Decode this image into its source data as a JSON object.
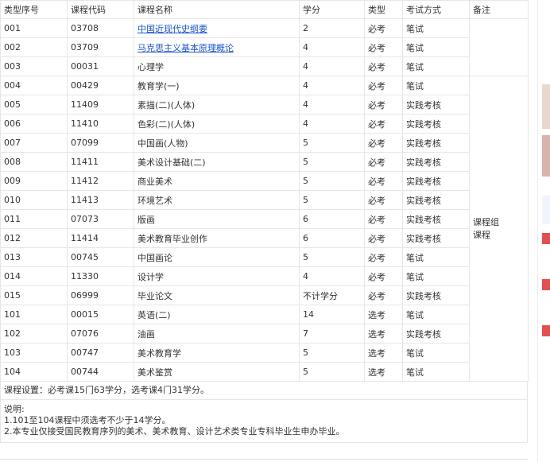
{
  "table": {
    "headers": [
      "类型序号",
      "课程代码",
      "课程名称",
      "学分",
      "类型",
      "考试方式",
      "备注"
    ],
    "rows": [
      {
        "seq": "001",
        "code": "03708",
        "name": "中国近现代史纲要",
        "credit": "2",
        "type": "必考",
        "exam": "笔试"
      },
      {
        "seq": "002",
        "code": "03709",
        "name": "马克思主义基本原理概论",
        "credit": "4",
        "type": "必考",
        "exam": "笔试"
      },
      {
        "seq": "003",
        "code": "00031",
        "name": "心理学",
        "credit": "4",
        "type": "必考",
        "exam": "笔试"
      },
      {
        "seq": "004",
        "code": "00429",
        "name": "教育学(一)",
        "credit": "4",
        "type": "必考",
        "exam": "笔试"
      },
      {
        "seq": "005",
        "code": "11409",
        "name": "素描(二)(人体)",
        "credit": "4",
        "type": "必考",
        "exam": "实践考核"
      },
      {
        "seq": "006",
        "code": "11410",
        "name": "色彩(二)(人体)",
        "credit": "4",
        "type": "必考",
        "exam": "实践考核"
      },
      {
        "seq": "007",
        "code": "07099",
        "name": "中国画(人物)",
        "credit": "5",
        "type": "必考",
        "exam": "实践考核"
      },
      {
        "seq": "008",
        "code": "11411",
        "name": "美术设计基础(二)",
        "credit": "5",
        "type": "必考",
        "exam": "实践考核"
      },
      {
        "seq": "009",
        "code": "11412",
        "name": "商业美术",
        "credit": "5",
        "type": "必考",
        "exam": "实践考核"
      },
      {
        "seq": "010",
        "code": "11413",
        "name": "环境艺术",
        "credit": "5",
        "type": "必考",
        "exam": "实践考核"
      },
      {
        "seq": "011",
        "code": "07073",
        "name": "版画",
        "credit": "6",
        "type": "必考",
        "exam": "实践考核"
      },
      {
        "seq": "012",
        "code": "11414",
        "name": "美术教育毕业创作",
        "credit": "6",
        "type": "必考",
        "exam": "实践考核"
      },
      {
        "seq": "013",
        "code": "00745",
        "name": "中国画论",
        "credit": "5",
        "type": "必考",
        "exam": "笔试"
      },
      {
        "seq": "014",
        "code": "11330",
        "name": "设计学",
        "credit": "4",
        "type": "必考",
        "exam": "笔试"
      },
      {
        "seq": "015",
        "code": "06999",
        "name": "毕业论文",
        "credit": "不计学分",
        "type": "必考",
        "exam": "实践考核"
      },
      {
        "seq": "101",
        "code": "00015",
        "name": "英语(二)",
        "credit": "14",
        "type": "选考",
        "exam": "笔试"
      },
      {
        "seq": "102",
        "code": "07076",
        "name": "油画",
        "credit": "7",
        "type": "选考",
        "exam": "实践考核"
      },
      {
        "seq": "103",
        "code": "00747",
        "name": "美术教育学",
        "credit": "5",
        "type": "选考",
        "exam": "笔试"
      },
      {
        "seq": "104",
        "code": "00744",
        "name": "美术鉴赏",
        "credit": "5",
        "type": "选考",
        "exam": "笔试"
      }
    ],
    "remark_group": "课程组\n课程",
    "link_color": "#1a55c9"
  },
  "summary": "课程设置：必考课15门63学分，选考课4门31学分。",
  "notes": {
    "title": "说明:",
    "lines": [
      "1.101至104课程中须选考不少于14学分。",
      "2.本专业仅接受国民教育序列的美术、美术教育、设计艺术类专业专科毕业生申办毕业。"
    ]
  },
  "side_strip_colors": [
    "#e8d6cf",
    "#d9b4ad",
    "#f2f4fb",
    "#e05050",
    "#e05050",
    "#e05050"
  ]
}
